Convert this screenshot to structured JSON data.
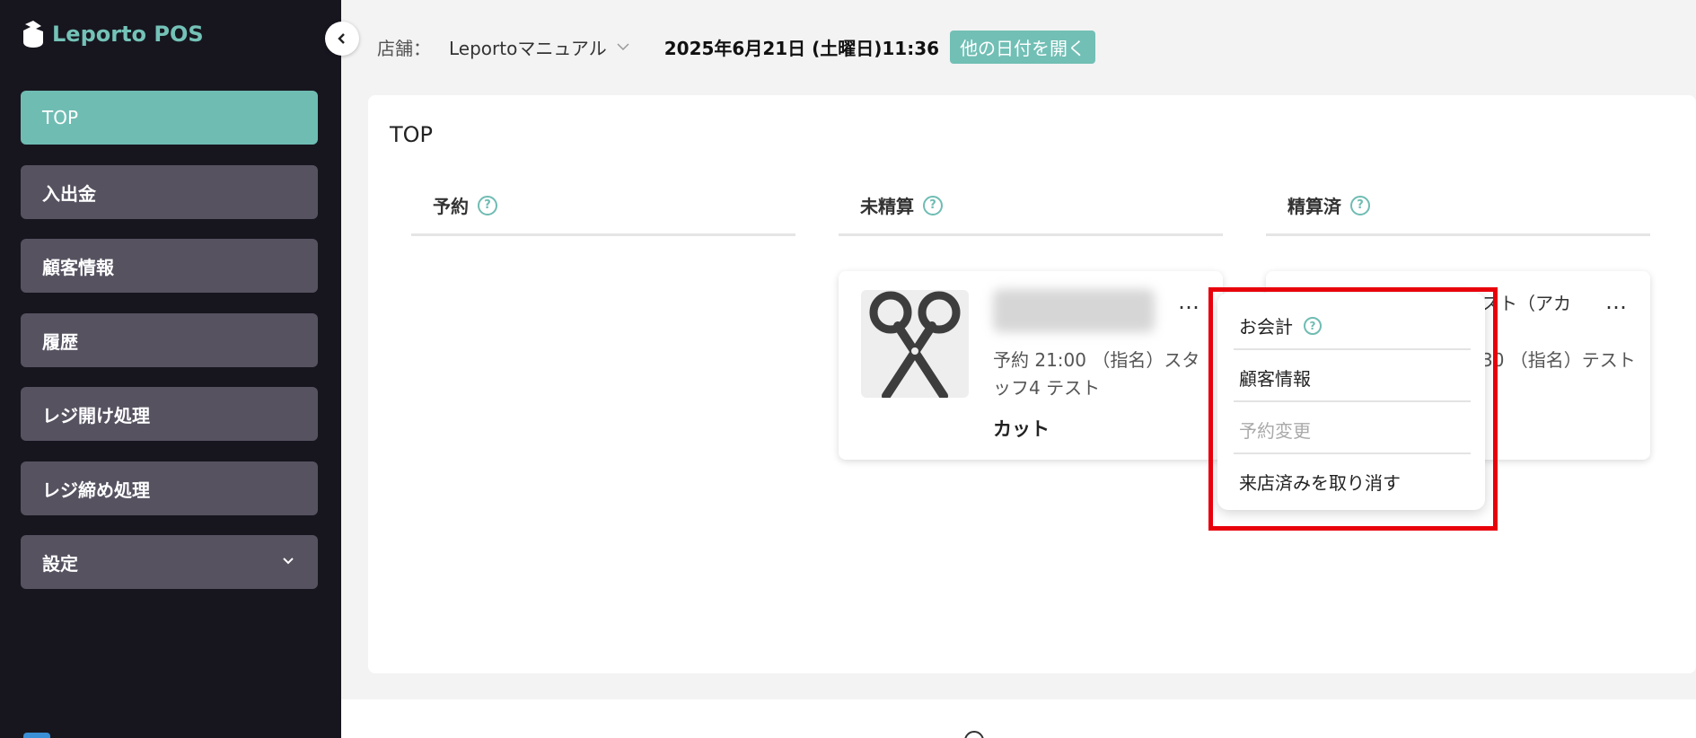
{
  "app": {
    "logo_text": "Leporto POS"
  },
  "sidebar": {
    "items": [
      {
        "label": "TOP"
      },
      {
        "label": "入出金"
      },
      {
        "label": "顧客情報"
      },
      {
        "label": "履歴"
      },
      {
        "label": "レジ開け処理"
      },
      {
        "label": "レジ締め処理"
      },
      {
        "label": "設定"
      }
    ]
  },
  "header": {
    "store_label": "店舗：",
    "store_value": "Leportoマニュアル",
    "datetime": "2025年6月21日 (土曜日)11:36",
    "other_date_button": "他の日付を開く"
  },
  "main": {
    "title": "TOP",
    "columns": [
      {
        "label": "予約"
      },
      {
        "label": "未精算"
      },
      {
        "label": "精算済"
      }
    ],
    "unsettled_card": {
      "more": "…",
      "reservation_line": "予約 21:00 （指名）スタッフ4 テスト",
      "menu": "カット"
    },
    "settled_card": {
      "name_partial": "スト（アカ",
      "more": "…",
      "reservation_line_partial": "30 （指名）テスト"
    }
  },
  "dropdown": {
    "items": [
      {
        "label": "お会計",
        "enabled": true
      },
      {
        "label": "顧客情報",
        "enabled": true
      },
      {
        "label": "予約変更",
        "enabled": false
      },
      {
        "label": "来店済みを取り消す",
        "enabled": true
      }
    ]
  },
  "colors": {
    "accent": "#6fbcb3",
    "sidebar_bg": "#17161f",
    "nav_bg": "#565260",
    "highlight": "#e8000b"
  }
}
